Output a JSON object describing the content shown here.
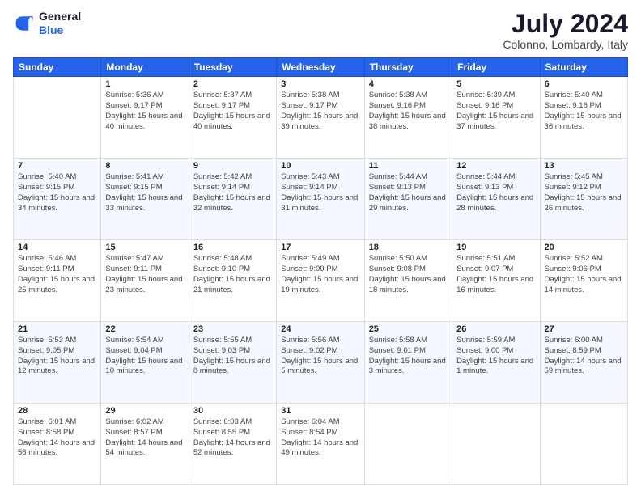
{
  "logo": {
    "line1": "General",
    "line2": "Blue"
  },
  "header": {
    "title": "July 2024",
    "subtitle": "Colonno, Lombardy, Italy"
  },
  "days": [
    "Sunday",
    "Monday",
    "Tuesday",
    "Wednesday",
    "Thursday",
    "Friday",
    "Saturday"
  ],
  "weeks": [
    [
      {
        "num": "",
        "sunrise": "",
        "sunset": "",
        "daylight": ""
      },
      {
        "num": "1",
        "sunrise": "Sunrise: 5:36 AM",
        "sunset": "Sunset: 9:17 PM",
        "daylight": "Daylight: 15 hours and 40 minutes."
      },
      {
        "num": "2",
        "sunrise": "Sunrise: 5:37 AM",
        "sunset": "Sunset: 9:17 PM",
        "daylight": "Daylight: 15 hours and 40 minutes."
      },
      {
        "num": "3",
        "sunrise": "Sunrise: 5:38 AM",
        "sunset": "Sunset: 9:17 PM",
        "daylight": "Daylight: 15 hours and 39 minutes."
      },
      {
        "num": "4",
        "sunrise": "Sunrise: 5:38 AM",
        "sunset": "Sunset: 9:16 PM",
        "daylight": "Daylight: 15 hours and 38 minutes."
      },
      {
        "num": "5",
        "sunrise": "Sunrise: 5:39 AM",
        "sunset": "Sunset: 9:16 PM",
        "daylight": "Daylight: 15 hours and 37 minutes."
      },
      {
        "num": "6",
        "sunrise": "Sunrise: 5:40 AM",
        "sunset": "Sunset: 9:16 PM",
        "daylight": "Daylight: 15 hours and 36 minutes."
      }
    ],
    [
      {
        "num": "7",
        "sunrise": "Sunrise: 5:40 AM",
        "sunset": "Sunset: 9:15 PM",
        "daylight": "Daylight: 15 hours and 34 minutes."
      },
      {
        "num": "8",
        "sunrise": "Sunrise: 5:41 AM",
        "sunset": "Sunset: 9:15 PM",
        "daylight": "Daylight: 15 hours and 33 minutes."
      },
      {
        "num": "9",
        "sunrise": "Sunrise: 5:42 AM",
        "sunset": "Sunset: 9:14 PM",
        "daylight": "Daylight: 15 hours and 32 minutes."
      },
      {
        "num": "10",
        "sunrise": "Sunrise: 5:43 AM",
        "sunset": "Sunset: 9:14 PM",
        "daylight": "Daylight: 15 hours and 31 minutes."
      },
      {
        "num": "11",
        "sunrise": "Sunrise: 5:44 AM",
        "sunset": "Sunset: 9:13 PM",
        "daylight": "Daylight: 15 hours and 29 minutes."
      },
      {
        "num": "12",
        "sunrise": "Sunrise: 5:44 AM",
        "sunset": "Sunset: 9:13 PM",
        "daylight": "Daylight: 15 hours and 28 minutes."
      },
      {
        "num": "13",
        "sunrise": "Sunrise: 5:45 AM",
        "sunset": "Sunset: 9:12 PM",
        "daylight": "Daylight: 15 hours and 26 minutes."
      }
    ],
    [
      {
        "num": "14",
        "sunrise": "Sunrise: 5:46 AM",
        "sunset": "Sunset: 9:11 PM",
        "daylight": "Daylight: 15 hours and 25 minutes."
      },
      {
        "num": "15",
        "sunrise": "Sunrise: 5:47 AM",
        "sunset": "Sunset: 9:11 PM",
        "daylight": "Daylight: 15 hours and 23 minutes."
      },
      {
        "num": "16",
        "sunrise": "Sunrise: 5:48 AM",
        "sunset": "Sunset: 9:10 PM",
        "daylight": "Daylight: 15 hours and 21 minutes."
      },
      {
        "num": "17",
        "sunrise": "Sunrise: 5:49 AM",
        "sunset": "Sunset: 9:09 PM",
        "daylight": "Daylight: 15 hours and 19 minutes."
      },
      {
        "num": "18",
        "sunrise": "Sunrise: 5:50 AM",
        "sunset": "Sunset: 9:08 PM",
        "daylight": "Daylight: 15 hours and 18 minutes."
      },
      {
        "num": "19",
        "sunrise": "Sunrise: 5:51 AM",
        "sunset": "Sunset: 9:07 PM",
        "daylight": "Daylight: 15 hours and 16 minutes."
      },
      {
        "num": "20",
        "sunrise": "Sunrise: 5:52 AM",
        "sunset": "Sunset: 9:06 PM",
        "daylight": "Daylight: 15 hours and 14 minutes."
      }
    ],
    [
      {
        "num": "21",
        "sunrise": "Sunrise: 5:53 AM",
        "sunset": "Sunset: 9:05 PM",
        "daylight": "Daylight: 15 hours and 12 minutes."
      },
      {
        "num": "22",
        "sunrise": "Sunrise: 5:54 AM",
        "sunset": "Sunset: 9:04 PM",
        "daylight": "Daylight: 15 hours and 10 minutes."
      },
      {
        "num": "23",
        "sunrise": "Sunrise: 5:55 AM",
        "sunset": "Sunset: 9:03 PM",
        "daylight": "Daylight: 15 hours and 8 minutes."
      },
      {
        "num": "24",
        "sunrise": "Sunrise: 5:56 AM",
        "sunset": "Sunset: 9:02 PM",
        "daylight": "Daylight: 15 hours and 5 minutes."
      },
      {
        "num": "25",
        "sunrise": "Sunrise: 5:58 AM",
        "sunset": "Sunset: 9:01 PM",
        "daylight": "Daylight: 15 hours and 3 minutes."
      },
      {
        "num": "26",
        "sunrise": "Sunrise: 5:59 AM",
        "sunset": "Sunset: 9:00 PM",
        "daylight": "Daylight: 15 hours and 1 minute."
      },
      {
        "num": "27",
        "sunrise": "Sunrise: 6:00 AM",
        "sunset": "Sunset: 8:59 PM",
        "daylight": "Daylight: 14 hours and 59 minutes."
      }
    ],
    [
      {
        "num": "28",
        "sunrise": "Sunrise: 6:01 AM",
        "sunset": "Sunset: 8:58 PM",
        "daylight": "Daylight: 14 hours and 56 minutes."
      },
      {
        "num": "29",
        "sunrise": "Sunrise: 6:02 AM",
        "sunset": "Sunset: 8:57 PM",
        "daylight": "Daylight: 14 hours and 54 minutes."
      },
      {
        "num": "30",
        "sunrise": "Sunrise: 6:03 AM",
        "sunset": "Sunset: 8:55 PM",
        "daylight": "Daylight: 14 hours and 52 minutes."
      },
      {
        "num": "31",
        "sunrise": "Sunrise: 6:04 AM",
        "sunset": "Sunset: 8:54 PM",
        "daylight": "Daylight: 14 hours and 49 minutes."
      },
      {
        "num": "",
        "sunrise": "",
        "sunset": "",
        "daylight": ""
      },
      {
        "num": "",
        "sunrise": "",
        "sunset": "",
        "daylight": ""
      },
      {
        "num": "",
        "sunrise": "",
        "sunset": "",
        "daylight": ""
      }
    ]
  ]
}
